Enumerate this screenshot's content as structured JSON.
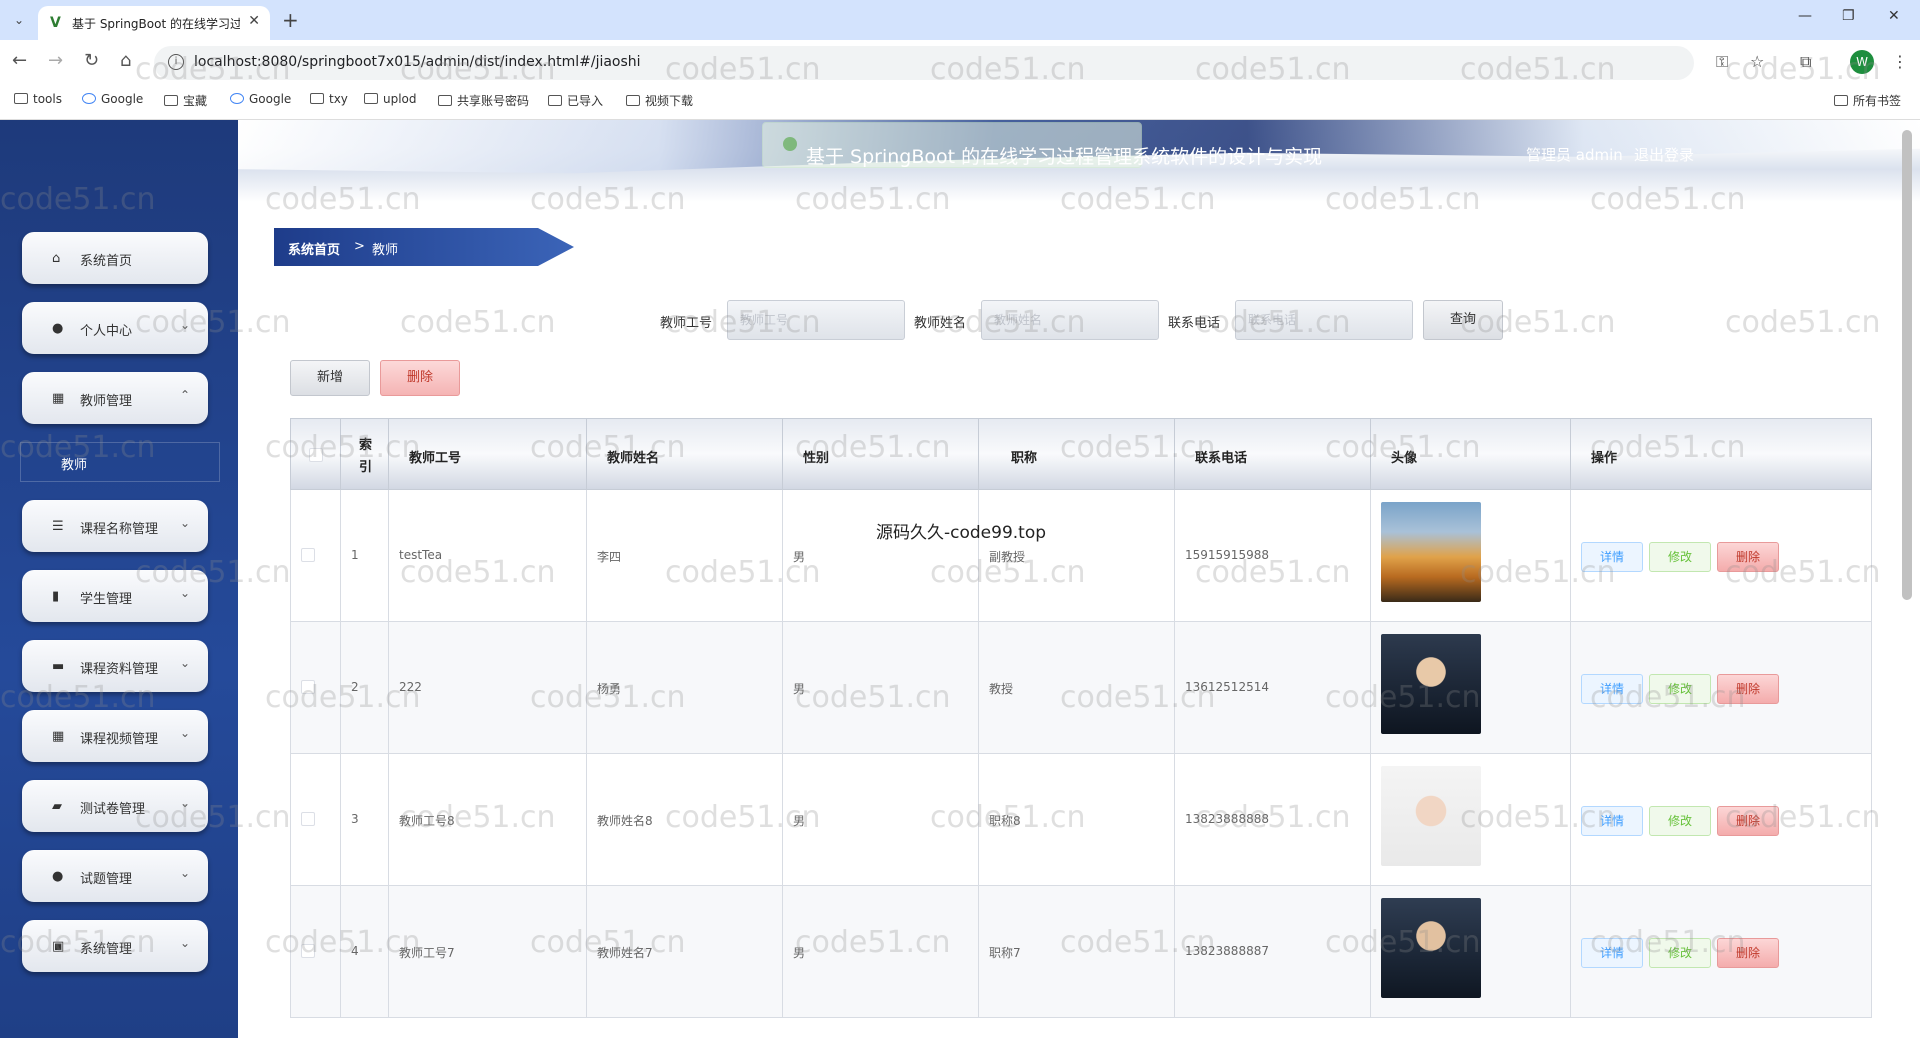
{
  "browser": {
    "tab_title": "基于 SpringBoot 的在线学习过",
    "url": "localhost:8080/springboot7x015/admin/dist/index.html#/jiaoshi",
    "bookmarks": [
      "tools",
      "Google",
      "宝藏",
      "Google",
      "txy",
      "uplod",
      "共享账号密码",
      "已导入",
      "视频下载",
      "所有书签"
    ]
  },
  "header": {
    "title": "基于 SpringBoot 的在线学习过程管理系统软件的设计与实现",
    "user": "管理员 admin",
    "logout": "退出登录"
  },
  "sidebar": {
    "items": [
      {
        "label": "系统首页",
        "icon": "home-icon",
        "arrow": ""
      },
      {
        "label": "个人中心",
        "icon": "user-icon",
        "arrow": "⌄"
      },
      {
        "label": "教师管理",
        "icon": "grid-icon",
        "arrow": "⌃"
      },
      {
        "label": "课程名称管理",
        "icon": "sliders-icon",
        "arrow": "⌄"
      },
      {
        "label": "学生管理",
        "icon": "bar-chart-icon",
        "arrow": "⌄"
      },
      {
        "label": "课程资料管理",
        "icon": "message-icon",
        "arrow": "⌄"
      },
      {
        "label": "课程视频管理",
        "icon": "grid-icon",
        "arrow": "⌄"
      },
      {
        "label": "测试卷管理",
        "icon": "briefcase-icon",
        "arrow": "⌄"
      },
      {
        "label": "试题管理",
        "icon": "user-icon",
        "arrow": "⌄"
      },
      {
        "label": "系统管理",
        "icon": "settings-icon",
        "arrow": "⌄"
      }
    ],
    "submenu": "教师"
  },
  "breadcrumb": {
    "home": "系统首页",
    "sep": ">",
    "current": "教师"
  },
  "filters": {
    "id_label": "教师工号",
    "id_placeholder": "教师工号",
    "name_label": "教师姓名",
    "name_placeholder": "教师姓名",
    "phone_label": "联系电话",
    "phone_placeholder": "联系电话",
    "search": "查询"
  },
  "actions": {
    "add": "新增",
    "delete": "删除"
  },
  "table": {
    "headers": [
      "索引",
      "教师工号",
      "教师姓名",
      "性别",
      "职称",
      "联系电话",
      "头像",
      "操作"
    ],
    "rows": [
      {
        "index": "1",
        "id": "testTea",
        "name": "李四",
        "gender": "男",
        "title": "副教授",
        "phone": "15915915988"
      },
      {
        "index": "2",
        "id": "222",
        "name": "杨勇",
        "gender": "男",
        "title": "教授",
        "phone": "13612512514"
      },
      {
        "index": "3",
        "id": "教师工号8",
        "name": "教师姓名8",
        "gender": "男",
        "title": "职称8",
        "phone": "13823888888"
      },
      {
        "index": "4",
        "id": "教师工号7",
        "name": "教师姓名7",
        "gender": "男",
        "title": "职称7",
        "phone": "13823888887"
      }
    ],
    "row_actions": {
      "detail": "详情",
      "edit": "修改",
      "delete": "删除"
    }
  },
  "watermark_text": "源码久久-code99.top",
  "site_watermark": "code51.cn"
}
